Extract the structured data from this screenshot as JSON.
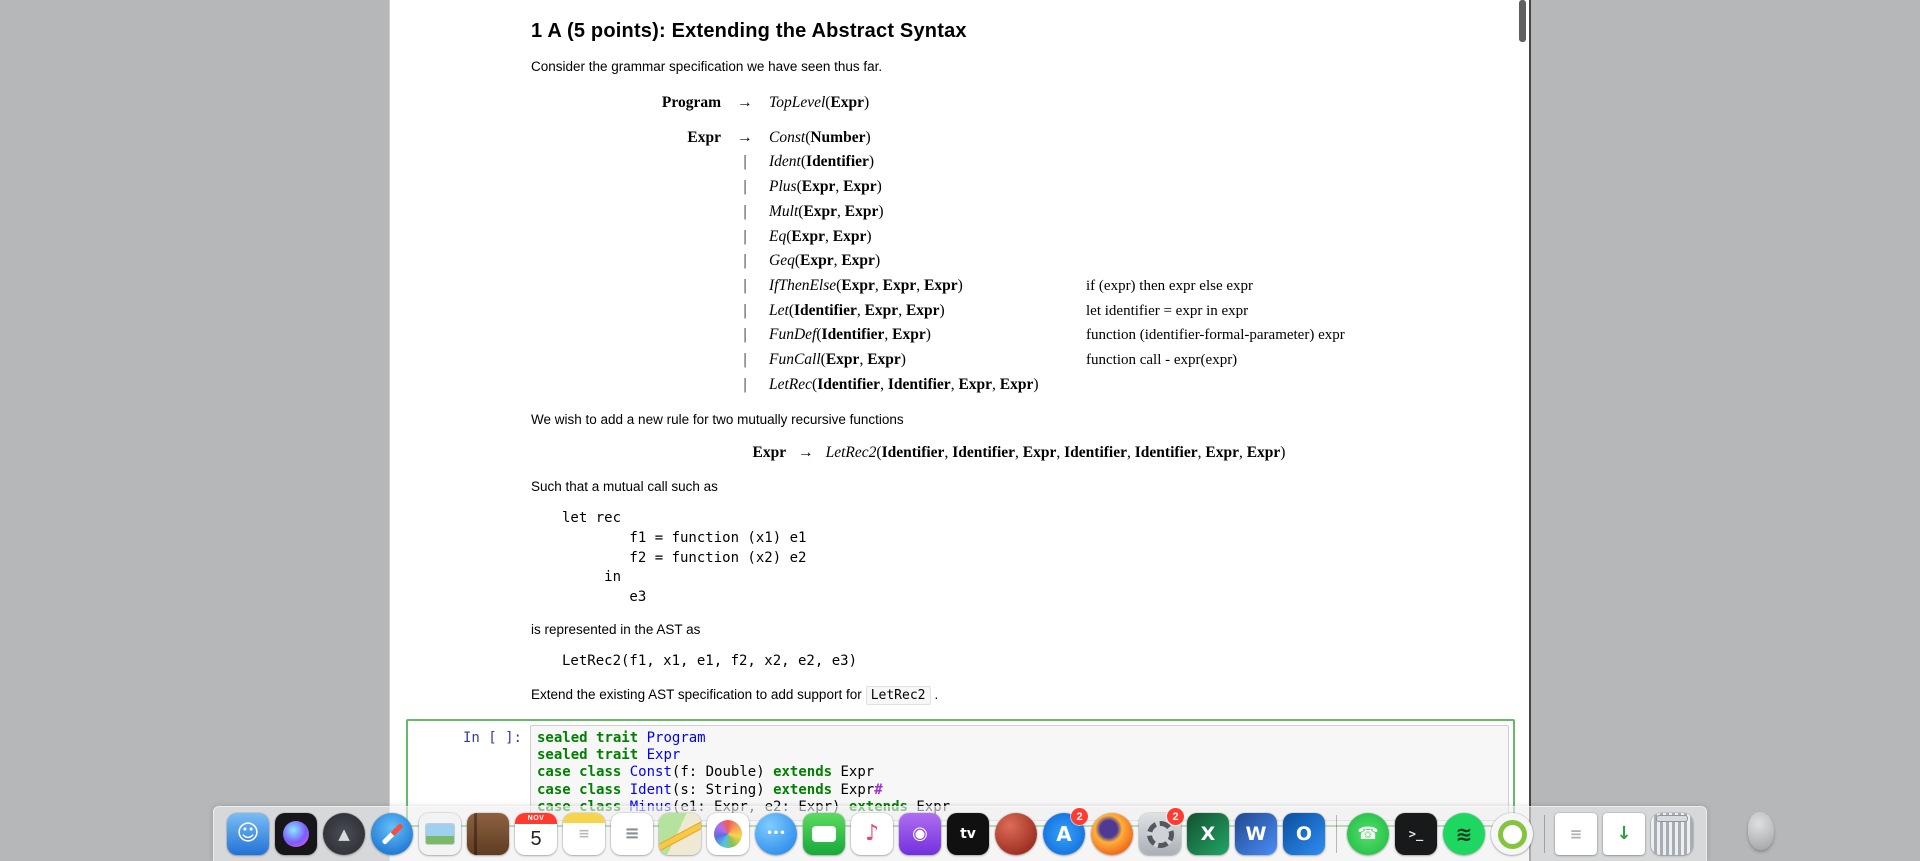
{
  "colors": {
    "desktop_bg": "#b5b7b9",
    "panel_bg": "#ffffff",
    "cell_border": "#66bb6a",
    "prompt": "#303f9f",
    "kw": "#008000",
    "def": "#0000ff",
    "cursor": "#9b2fd6",
    "badge": "#ff3b30",
    "inline_code_bg": "#f7f7f7"
  },
  "document": {
    "title": "1 A (5 points): Extending the Abstract Syntax",
    "intro": "Consider the grammar specification we have seen thus far.",
    "grammar_program": {
      "lhs": "Program",
      "arrow": "→",
      "productions": [
        {
          "name": "TopLevel",
          "args": [
            "Expr"
          ],
          "note": ""
        }
      ]
    },
    "grammar_expr": {
      "lhs": "Expr",
      "arrow": "→",
      "productions": [
        {
          "name": "Const",
          "args": [
            "Number"
          ],
          "note": ""
        },
        {
          "name": "Ident",
          "args": [
            "Identifier"
          ],
          "note": ""
        },
        {
          "name": "Plus",
          "args": [
            "Expr",
            "Expr"
          ],
          "note": ""
        },
        {
          "name": "Mult",
          "args": [
            "Expr",
            "Expr"
          ],
          "note": ""
        },
        {
          "name": "Eq",
          "args": [
            "Expr",
            "Expr"
          ],
          "note": ""
        },
        {
          "name": "Geq",
          "args": [
            "Expr",
            "Expr"
          ],
          "note": ""
        },
        {
          "name": "IfThenElse",
          "args": [
            "Expr",
            "Expr",
            "Expr"
          ],
          "note": "if (expr) then expr else expr"
        },
        {
          "name": "Let",
          "args": [
            "Identifier",
            "Expr",
            "Expr"
          ],
          "note": "let identifier = expr in expr"
        },
        {
          "name": "FunDef",
          "args": [
            "Identifier",
            "Expr"
          ],
          "note": "function (identifier-formal-parameter) expr"
        },
        {
          "name": "FunCall",
          "args": [
            "Expr",
            "Expr"
          ],
          "note": "function call - expr(expr)"
        },
        {
          "name": "LetRec",
          "args": [
            "Identifier",
            "Identifier",
            "Expr",
            "Expr"
          ],
          "note": ""
        }
      ]
    },
    "para_new_rule": "We wish to add a new rule for two mutually recursive functions",
    "new_rule": {
      "lhs": "Expr",
      "arrow": "→",
      "name": "LetRec2",
      "args": [
        "Identifier",
        "Identifier",
        "Expr",
        "Identifier",
        "Identifier",
        "Expr",
        "Expr"
      ]
    },
    "para_such_that": "Such that a mutual call such as",
    "code_example": [
      "let rec",
      "        f1 = function (x1) e1",
      "        f2 = function (x2) e2",
      "     in",
      "        e3"
    ],
    "para_ast": "is represented in the AST as",
    "code_ast": "LetRec2(f1, x1, e1, f2, x2, e2, e3)",
    "para_extend_prefix": "Extend the existing AST specification to add support for",
    "extend_code": "LetRec2",
    "para_extend_suffix": "."
  },
  "cell": {
    "prompt": "In [ ]:",
    "lines": [
      [
        {
          "t": "sealed",
          "c": "kw"
        },
        {
          "t": " "
        },
        {
          "t": "trait",
          "c": "kw"
        },
        {
          "t": " "
        },
        {
          "t": "Program",
          "c": "df"
        }
      ],
      [
        {
          "t": "sealed",
          "c": "kw"
        },
        {
          "t": " "
        },
        {
          "t": "trait",
          "c": "kw"
        },
        {
          "t": " "
        },
        {
          "t": "Expr",
          "c": "df"
        }
      ],
      [
        {
          "t": "case",
          "c": "kw"
        },
        {
          "t": " "
        },
        {
          "t": "class",
          "c": "kw"
        },
        {
          "t": " "
        },
        {
          "t": "Const",
          "c": "df"
        },
        {
          "t": "(f: Double) "
        },
        {
          "t": "extends",
          "c": "kw"
        },
        {
          "t": " Expr"
        }
      ],
      [
        {
          "t": "case",
          "c": "kw"
        },
        {
          "t": " "
        },
        {
          "t": "class",
          "c": "kw"
        },
        {
          "t": " "
        },
        {
          "t": "Ident",
          "c": "df"
        },
        {
          "t": "(s: String) "
        },
        {
          "t": "extends",
          "c": "kw"
        },
        {
          "t": " Expr"
        },
        {
          "t": "#",
          "c": "cur"
        }
      ],
      [
        {
          "t": "case",
          "c": "kw"
        },
        {
          "t": " "
        },
        {
          "t": "class",
          "c": "kw"
        },
        {
          "t": " "
        },
        {
          "t": "Minus",
          "c": "df"
        },
        {
          "t": "(e1: Expr, e2: Expr) "
        },
        {
          "t": "extends",
          "c": "kw"
        },
        {
          "t": " Expr"
        }
      ]
    ]
  },
  "dock": {
    "items": [
      {
        "name": "finder",
        "shape": "square",
        "bg": "linear-gradient(180deg,#79bdf4,#2272d7)",
        "glyph": "☺",
        "fg": "#ffffff",
        "size": 22
      },
      {
        "name": "siri",
        "shape": "square",
        "bg": "#17171a",
        "inner": "orb"
      },
      {
        "name": "launchpad",
        "shape": "circle",
        "bg": "radial-gradient(circle,#4a4e55,#26292e)",
        "glyph": "▲",
        "fg": "#d8dadd",
        "size": 15
      },
      {
        "name": "safari",
        "shape": "circle",
        "bg": "radial-gradient(circle at 50% 35%,#63c1f8,#1064ca)",
        "inner": "needle"
      },
      {
        "name": "preview",
        "shape": "square",
        "bg": "#f2f3f4",
        "inner": "photo"
      },
      {
        "name": "contacts",
        "shape": "square",
        "bg": "linear-gradient(180deg,#8e6140,#5f3c22)",
        "inner": "spine"
      },
      {
        "name": "calendar",
        "shape": "square",
        "bg": "#ffffff",
        "cal_top": "NOV",
        "cal_day": "5"
      },
      {
        "name": "notes",
        "shape": "square",
        "bg": "linear-gradient(180deg,#f6d44c 0,#f6d44c 24%,#ffffff 24%)",
        "glyph": "≡",
        "fg": "#b9b9b9",
        "size": 14
      },
      {
        "name": "reminders",
        "shape": "square",
        "bg": "#ffffff",
        "glyph": "≡",
        "fg": "#8a8f94",
        "size": 18
      },
      {
        "name": "maps",
        "shape": "square",
        "bg": "linear-gradient(115deg,#b5e39d 0,#b5e39d 45%,#efe9d4 45%,#efe9d4 100%)",
        "inner": "road"
      },
      {
        "name": "photos",
        "shape": "square",
        "bg": "#ffffff",
        "inner": "flower"
      },
      {
        "name": "messages",
        "shape": "circle",
        "bg": "radial-gradient(circle at 35% 30%,#7fccff,#1a7fe8)",
        "glyph": "•••",
        "fg": "#ffffff",
        "size": 10
      },
      {
        "name": "facetime",
        "shape": "square",
        "bg": "linear-gradient(180deg,#5cdb60,#17a83a)",
        "inner": "camera"
      },
      {
        "name": "music",
        "shape": "square",
        "bg": "#ffffff",
        "glyph": "♪",
        "fg": "#e8486b",
        "size": 22
      },
      {
        "name": "podcasts",
        "shape": "square",
        "bg": "linear-gradient(180deg,#b06ef2,#7230dd)",
        "glyph": "◉",
        "fg": "#ffffff",
        "size": 18
      },
      {
        "name": "tv",
        "shape": "square",
        "bg": "#101010",
        "glyph": "tv",
        "fg": "#ffffff",
        "size": 14
      },
      {
        "name": "red-sphere",
        "shape": "circle",
        "bg": "radial-gradient(circle at 35% 30%,#de6b57,#871c10)"
      },
      {
        "name": "app-store",
        "shape": "circle",
        "bg": "radial-gradient(circle,#35a3f9,#0b63d8)",
        "glyph": "A",
        "fg": "#ffffff",
        "size": 20,
        "badge": "2"
      },
      {
        "name": "firefox",
        "shape": "circle",
        "bg": "radial-gradient(circle at 42% 38%,#4e3a94 0,#4e3a94 24%,#ffb03a 38%,#f1701f 70%,#da5310 100%)"
      },
      {
        "name": "system-preferences",
        "shape": "square",
        "bg": "linear-gradient(180deg,#dfe1e4,#aab0b6)",
        "inner": "gear",
        "badge": "2"
      },
      {
        "name": "excel",
        "shape": "square",
        "bg": "linear-gradient(135deg,#13512f,#22a566)",
        "glyph": "X",
        "fg": "#ffffff",
        "size": 19
      },
      {
        "name": "word",
        "shape": "square",
        "bg": "linear-gradient(135deg,#21498f,#4a8cf7)",
        "glyph": "W",
        "fg": "#ffffff",
        "size": 19
      },
      {
        "name": "outlook",
        "shape": "square",
        "bg": "linear-gradient(135deg,#0a4f9e,#2f8df2)",
        "glyph": "O",
        "fg": "#ffffff",
        "size": 19
      },
      {
        "divider": true
      },
      {
        "name": "whatsapp",
        "shape": "circle",
        "bg": "radial-gradient(circle,#53e16a,#1cb842)",
        "glyph": "☎",
        "fg": "#ffffff",
        "size": 17
      },
      {
        "name": "terminal",
        "shape": "square",
        "bg": "#17191b",
        "glyph": ">_",
        "fg": "#e6e6e6",
        "size": 12,
        "mono": true
      },
      {
        "name": "spotify",
        "shape": "circle",
        "bg": "#1ed760",
        "glyph": "≋",
        "fg": "#0b3a1d",
        "size": 20
      },
      {
        "name": "green-ring-app",
        "shape": "circle",
        "bg": "#f5f6f6",
        "inner": "ring"
      },
      {
        "divider": true
      },
      {
        "name": "text-document",
        "shape": "page",
        "bg": "#ffffff",
        "glyph": "≡",
        "fg": "#b0b0b0",
        "size": 15
      },
      {
        "name": "downloads",
        "shape": "page",
        "bg": "#ffffff",
        "glyph": "↓",
        "fg": "#2f9e44",
        "size": 18
      },
      {
        "name": "trash",
        "shape": "square",
        "bg": "repeating-linear-gradient(90deg,#eceff1 0px,#eceff1 3px,#a7adb3 3px,#a7adb3 6px)",
        "inner": "trashlid"
      }
    ]
  }
}
